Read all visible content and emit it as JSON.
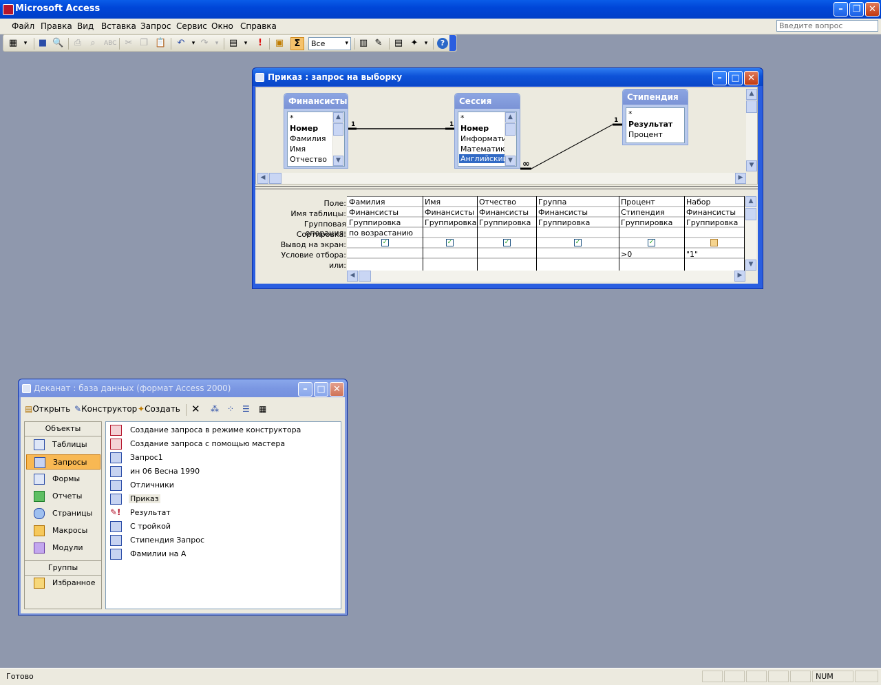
{
  "app": {
    "title": "Microsoft Access"
  },
  "menu": [
    "Файл",
    "Правка",
    "Вид",
    "Вставка",
    "Запрос",
    "Сервис",
    "Окно",
    "Справка"
  ],
  "ask_placeholder": "Введите вопрос",
  "toolbar": {
    "top_values": "Все",
    "sigma": "Σ"
  },
  "query_window": {
    "title": "Приказ : запрос на выборку",
    "tables": [
      {
        "name": "Финансисты",
        "fields": [
          "*",
          "Номер",
          "Фамилия",
          "Имя",
          "Отчество"
        ]
      },
      {
        "name": "Сессия",
        "fields": [
          "*",
          "Номер",
          "Информатика",
          "Математика",
          "Английский я"
        ]
      },
      {
        "name": "Стипендия",
        "fields": [
          "*",
          "Результат",
          "Процент"
        ]
      }
    ],
    "relations": {
      "one_a": "1",
      "one_b": "1",
      "one_c": "1",
      "many": "∞"
    },
    "grid": {
      "row_labels": [
        "Поле:",
        "Имя таблицы:",
        "Групповая операция:",
        "Сортировка:",
        "Вывод на экран:",
        "Условие отбора:",
        "или:"
      ],
      "columns": [
        {
          "field": "Фамилия",
          "table": "Финансисты",
          "group": "Группировка",
          "sort": "по возрастанию",
          "show": true,
          "criteria": ""
        },
        {
          "field": "Имя",
          "table": "Финансисты",
          "group": "Группировка",
          "sort": "",
          "show": true,
          "criteria": ""
        },
        {
          "field": "Отчество",
          "table": "Финансисты",
          "group": "Группировка",
          "sort": "",
          "show": true,
          "criteria": ""
        },
        {
          "field": "Группа",
          "table": "Финансисты",
          "group": "Группировка",
          "sort": "",
          "show": true,
          "criteria": ""
        },
        {
          "field": "Процент",
          "table": "Стипендия",
          "group": "Группировка",
          "sort": "",
          "show": true,
          "criteria": ">0"
        },
        {
          "field": "Набор",
          "table": "Финансисты",
          "group": "Группировка",
          "sort": "",
          "show": false,
          "criteria": "\"1\""
        }
      ]
    }
  },
  "db_window": {
    "title": "Деканат : база данных (формат Access 2000)",
    "toolbar": {
      "open": "Открыть",
      "design": "Конструктор",
      "create": "Создать"
    },
    "objects_header": "Объекты",
    "objects": [
      "Таблицы",
      "Запросы",
      "Формы",
      "Отчеты",
      "Страницы",
      "Макросы",
      "Модули"
    ],
    "selected_object": "Запросы",
    "groups_header": "Группы",
    "groups": [
      "Избранное"
    ],
    "items": [
      {
        "label": "Создание запроса в режиме конструктора",
        "icon": "wizard-icon"
      },
      {
        "label": "Создание запроса с помощью мастера",
        "icon": "wizard-icon"
      },
      {
        "label": "Запрос1",
        "icon": "select-query-icon"
      },
      {
        "label": "ин 06 Весна 1990",
        "icon": "select-query-icon"
      },
      {
        "label": "Отличники",
        "icon": "select-query-icon"
      },
      {
        "label": "Приказ",
        "icon": "select-query-icon"
      },
      {
        "label": "Результат",
        "icon": "action-query-icon"
      },
      {
        "label": "С тройкой",
        "icon": "select-query-icon"
      },
      {
        "label": "Стипендия Запрос",
        "icon": "select-query-icon"
      },
      {
        "label": "Фамилии на А",
        "icon": "select-query-icon"
      }
    ],
    "highlighted_item": "Приказ"
  },
  "status": {
    "text": "Готово",
    "num": "NUM"
  }
}
